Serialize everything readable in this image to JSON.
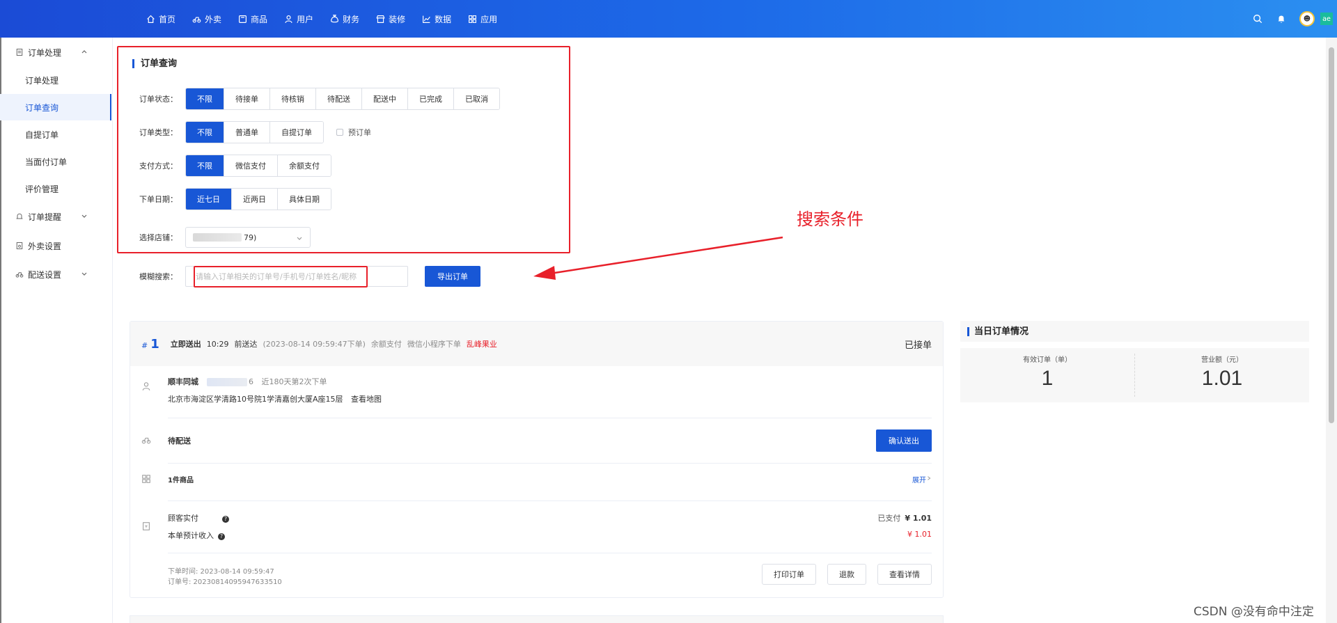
{
  "nav": {
    "items": [
      {
        "label": "首页",
        "icon": "home-icon"
      },
      {
        "label": "外卖",
        "icon": "bike-icon"
      },
      {
        "label": "商品",
        "icon": "goods-icon"
      },
      {
        "label": "用户",
        "icon": "user-icon"
      },
      {
        "label": "财务",
        "icon": "finance-icon"
      },
      {
        "label": "装修",
        "icon": "shop-icon"
      },
      {
        "label": "数据",
        "icon": "chart-icon"
      },
      {
        "label": "应用",
        "icon": "apps-icon"
      }
    ],
    "right_badge": "ae"
  },
  "sidebar": {
    "groups": [
      {
        "label": "订单处理"
      },
      {
        "label": "订单提醒"
      },
      {
        "label": "外卖设置"
      },
      {
        "label": "配送设置"
      }
    ],
    "items": [
      {
        "label": "订单处理"
      },
      {
        "label": "订单查询"
      },
      {
        "label": "自提订单"
      },
      {
        "label": "当面付订单"
      },
      {
        "label": "评价管理"
      }
    ]
  },
  "search": {
    "title": "订单查询",
    "status_label": "订单状态：",
    "status_options": [
      "不限",
      "待接单",
      "待核销",
      "待配送",
      "配送中",
      "已完成",
      "已取消"
    ],
    "type_label": "订单类型：",
    "type_options": [
      "不限",
      "普通单",
      "自提订单"
    ],
    "preorder_label": "预订单",
    "pay_label": "支付方式：",
    "pay_options": [
      "不限",
      "微信支付",
      "余额支付"
    ],
    "date_label": "下单日期：",
    "date_options": [
      "近七日",
      "近两日",
      "具体日期"
    ],
    "store_label": "选择店铺：",
    "store_value_suffix": "79)",
    "fuzzy_label": "模糊搜索：",
    "fuzzy_placeholder": "请输入订单相关的订单号/手机号/订单姓名/昵称",
    "export_button": "导出订单"
  },
  "annotation": {
    "text": "搜索条件",
    "color": "#e8202a"
  },
  "order": {
    "hash": "#",
    "number": "1",
    "delivery_mode": "立即送出",
    "deliver_time": "10:29",
    "deliver_before": "前送达",
    "created_paren": "(2023-08-14 09:59:47下单)",
    "pay_method": "余额支付",
    "source": "微信小程序下单",
    "shop_name": "乱峰果业",
    "status": "已接单",
    "customer_name": "顺丰同城",
    "phone_suffix": "6",
    "order_count_note": "近180天第2次下单",
    "address": "北京市海淀区学清路10号院1学清嘉创大厦A座15层",
    "map_link": "查看地图",
    "delivery_status": "待配送",
    "confirm_button": "确认送出",
    "goods_count": "1件商品",
    "expand_link": "展开",
    "customer_paid_label": "顾客实付",
    "paid_status": "已支付",
    "paid_amount": "¥ 1.01",
    "income_label": "本单预计收入",
    "income_amount": "¥ 1.01",
    "order_time": "下单时间: 2023-08-14 09:59:47",
    "order_no": "订单号: 20230814095947633510",
    "print_button": "打印订单",
    "refund_button": "退款",
    "detail_button": "查看详情"
  },
  "summary": {
    "title": "当日订单情况",
    "valid_orders_label": "有效订单（单）",
    "valid_orders_value": "1",
    "revenue_label": "营业额（元）",
    "revenue_value": "1.01"
  },
  "watermark": "CSDN @没有命中注定",
  "colors": {
    "primary": "#1857d6",
    "danger": "#e8202a"
  }
}
